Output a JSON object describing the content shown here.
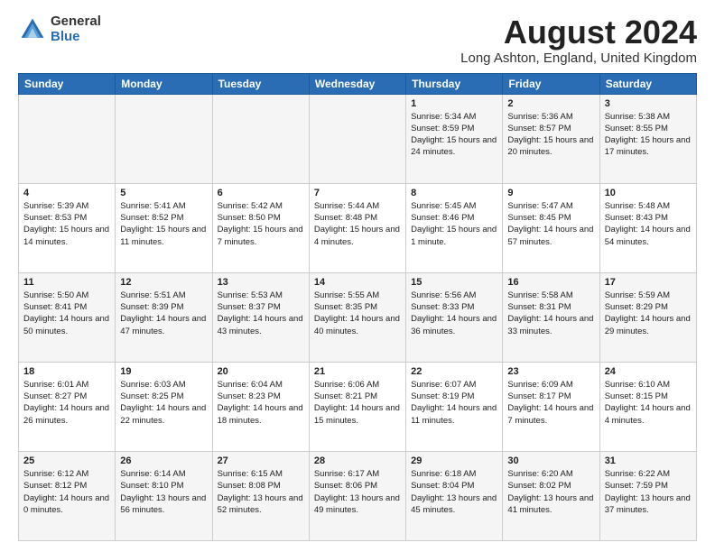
{
  "header": {
    "logo_general": "General",
    "logo_blue": "Blue",
    "title": "August 2024",
    "location": "Long Ashton, England, United Kingdom"
  },
  "days_of_week": [
    "Sunday",
    "Monday",
    "Tuesday",
    "Wednesday",
    "Thursday",
    "Friday",
    "Saturday"
  ],
  "weeks": [
    [
      {
        "day": "",
        "info": ""
      },
      {
        "day": "",
        "info": ""
      },
      {
        "day": "",
        "info": ""
      },
      {
        "day": "",
        "info": ""
      },
      {
        "day": "1",
        "info": "Sunrise: 5:34 AM\nSunset: 8:59 PM\nDaylight: 15 hours and 24 minutes."
      },
      {
        "day": "2",
        "info": "Sunrise: 5:36 AM\nSunset: 8:57 PM\nDaylight: 15 hours and 20 minutes."
      },
      {
        "day": "3",
        "info": "Sunrise: 5:38 AM\nSunset: 8:55 PM\nDaylight: 15 hours and 17 minutes."
      }
    ],
    [
      {
        "day": "4",
        "info": "Sunrise: 5:39 AM\nSunset: 8:53 PM\nDaylight: 15 hours and 14 minutes."
      },
      {
        "day": "5",
        "info": "Sunrise: 5:41 AM\nSunset: 8:52 PM\nDaylight: 15 hours and 11 minutes."
      },
      {
        "day": "6",
        "info": "Sunrise: 5:42 AM\nSunset: 8:50 PM\nDaylight: 15 hours and 7 minutes."
      },
      {
        "day": "7",
        "info": "Sunrise: 5:44 AM\nSunset: 8:48 PM\nDaylight: 15 hours and 4 minutes."
      },
      {
        "day": "8",
        "info": "Sunrise: 5:45 AM\nSunset: 8:46 PM\nDaylight: 15 hours and 1 minute."
      },
      {
        "day": "9",
        "info": "Sunrise: 5:47 AM\nSunset: 8:45 PM\nDaylight: 14 hours and 57 minutes."
      },
      {
        "day": "10",
        "info": "Sunrise: 5:48 AM\nSunset: 8:43 PM\nDaylight: 14 hours and 54 minutes."
      }
    ],
    [
      {
        "day": "11",
        "info": "Sunrise: 5:50 AM\nSunset: 8:41 PM\nDaylight: 14 hours and 50 minutes."
      },
      {
        "day": "12",
        "info": "Sunrise: 5:51 AM\nSunset: 8:39 PM\nDaylight: 14 hours and 47 minutes."
      },
      {
        "day": "13",
        "info": "Sunrise: 5:53 AM\nSunset: 8:37 PM\nDaylight: 14 hours and 43 minutes."
      },
      {
        "day": "14",
        "info": "Sunrise: 5:55 AM\nSunset: 8:35 PM\nDaylight: 14 hours and 40 minutes."
      },
      {
        "day": "15",
        "info": "Sunrise: 5:56 AM\nSunset: 8:33 PM\nDaylight: 14 hours and 36 minutes."
      },
      {
        "day": "16",
        "info": "Sunrise: 5:58 AM\nSunset: 8:31 PM\nDaylight: 14 hours and 33 minutes."
      },
      {
        "day": "17",
        "info": "Sunrise: 5:59 AM\nSunset: 8:29 PM\nDaylight: 14 hours and 29 minutes."
      }
    ],
    [
      {
        "day": "18",
        "info": "Sunrise: 6:01 AM\nSunset: 8:27 PM\nDaylight: 14 hours and 26 minutes."
      },
      {
        "day": "19",
        "info": "Sunrise: 6:03 AM\nSunset: 8:25 PM\nDaylight: 14 hours and 22 minutes."
      },
      {
        "day": "20",
        "info": "Sunrise: 6:04 AM\nSunset: 8:23 PM\nDaylight: 14 hours and 18 minutes."
      },
      {
        "day": "21",
        "info": "Sunrise: 6:06 AM\nSunset: 8:21 PM\nDaylight: 14 hours and 15 minutes."
      },
      {
        "day": "22",
        "info": "Sunrise: 6:07 AM\nSunset: 8:19 PM\nDaylight: 14 hours and 11 minutes."
      },
      {
        "day": "23",
        "info": "Sunrise: 6:09 AM\nSunset: 8:17 PM\nDaylight: 14 hours and 7 minutes."
      },
      {
        "day": "24",
        "info": "Sunrise: 6:10 AM\nSunset: 8:15 PM\nDaylight: 14 hours and 4 minutes."
      }
    ],
    [
      {
        "day": "25",
        "info": "Sunrise: 6:12 AM\nSunset: 8:12 PM\nDaylight: 14 hours and 0 minutes."
      },
      {
        "day": "26",
        "info": "Sunrise: 6:14 AM\nSunset: 8:10 PM\nDaylight: 13 hours and 56 minutes."
      },
      {
        "day": "27",
        "info": "Sunrise: 6:15 AM\nSunset: 8:08 PM\nDaylight: 13 hours and 52 minutes."
      },
      {
        "day": "28",
        "info": "Sunrise: 6:17 AM\nSunset: 8:06 PM\nDaylight: 13 hours and 49 minutes."
      },
      {
        "day": "29",
        "info": "Sunrise: 6:18 AM\nSunset: 8:04 PM\nDaylight: 13 hours and 45 minutes."
      },
      {
        "day": "30",
        "info": "Sunrise: 6:20 AM\nSunset: 8:02 PM\nDaylight: 13 hours and 41 minutes."
      },
      {
        "day": "31",
        "info": "Sunrise: 6:22 AM\nSunset: 7:59 PM\nDaylight: 13 hours and 37 minutes."
      }
    ]
  ]
}
